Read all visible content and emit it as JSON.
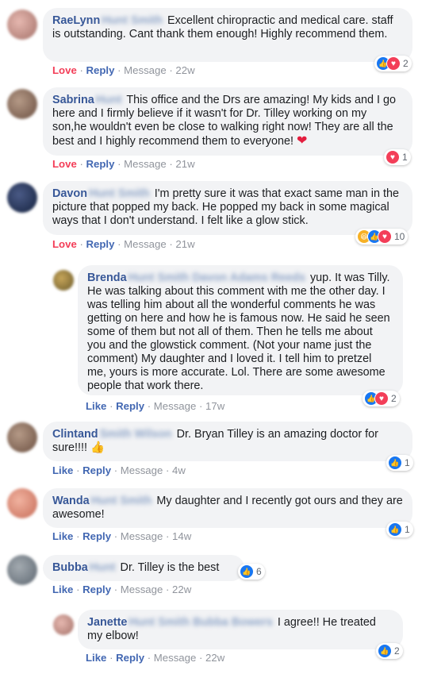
{
  "comments": [
    {
      "name": "RaeLynn",
      "text": "Excellent chiropractic and medical care. staff is outstanding. Cant thank them enough! Highly recommend them.",
      "actions": {
        "react": "Love",
        "reply": "Reply",
        "message": "Message",
        "time": "22w"
      },
      "reaction_count": "2",
      "reaction_types": [
        "like-icon",
        "love-icon"
      ]
    },
    {
      "name": "Sabrina",
      "text": "This office and the Drs are amazing! My kids and I go here and I firmly believe if it wasn't for Dr. Tilley working on my son,he wouldn't even be close to walking right now! They are all the best and I highly recommend them to everyone!",
      "emoji": "❤",
      "actions": {
        "react": "Love",
        "reply": "Reply",
        "message": "Message",
        "time": "21w"
      },
      "reaction_count": "1",
      "reaction_types": [
        "love-icon"
      ]
    },
    {
      "name": "Davon",
      "text": "I'm pretty sure it was that exact same man in the picture that popped my back. He popped my back in some magical ways that I don't understand. I felt like a glow stick.",
      "actions": {
        "react": "Love",
        "reply": "Reply",
        "message": "Message",
        "time": "21w"
      },
      "reaction_count": "10",
      "reaction_types": [
        "haha-icon",
        "like-icon",
        "love-icon"
      ]
    },
    {
      "name": "Brenda",
      "text": "yup. It was Tilly. He was talking about this comment with me the other day. I was telling him about all the wonderful comments he was getting on here and how he is famous now. He said he seen some of them but not all of them. Then he tells me about you and the glowstick comment. (Not your name just the comment) My daughter and I loved it. I tell him to pretzel me, yours is more accurate. Lol. There are some awesome people that work there.",
      "actions": {
        "react": "Like",
        "reply": "Reply",
        "message": "Message",
        "time": "17w"
      },
      "reaction_count": "2",
      "reaction_types": [
        "like-icon",
        "love-icon"
      ]
    },
    {
      "name": "Clintand",
      "text": "Dr. Bryan Tilley is an amazing doctor for sure!!!!",
      "emoji": "👍",
      "actions": {
        "react": "Like",
        "reply": "Reply",
        "message": "Message",
        "time": "4w"
      },
      "reaction_count": "1",
      "reaction_types": [
        "like-icon"
      ]
    },
    {
      "name": "Wanda",
      "text": "My daughter and I recently got ours and they are awesome!",
      "actions": {
        "react": "Like",
        "reply": "Reply",
        "message": "Message",
        "time": "14w"
      },
      "reaction_count": "1",
      "reaction_types": [
        "like-icon"
      ]
    },
    {
      "name": "Bubba",
      "text": "Dr. Tilley is the best",
      "actions": {
        "react": "Like",
        "reply": "Reply",
        "message": "Message",
        "time": "22w"
      },
      "reaction_count": "6",
      "reaction_types": [
        "like-icon"
      ]
    },
    {
      "name": "Janette",
      "text": "I agree!! He treated my elbow!",
      "actions": {
        "react": "Like",
        "reply": "Reply",
        "message": "Message",
        "time": "22w"
      },
      "reaction_count": "2",
      "reaction_types": [
        "like-icon"
      ]
    }
  ],
  "colors": {
    "link": "#4267b2",
    "name": "#385898",
    "love": "#f33e58",
    "bubble": "#f2f3f5",
    "meta": "#90949c"
  }
}
